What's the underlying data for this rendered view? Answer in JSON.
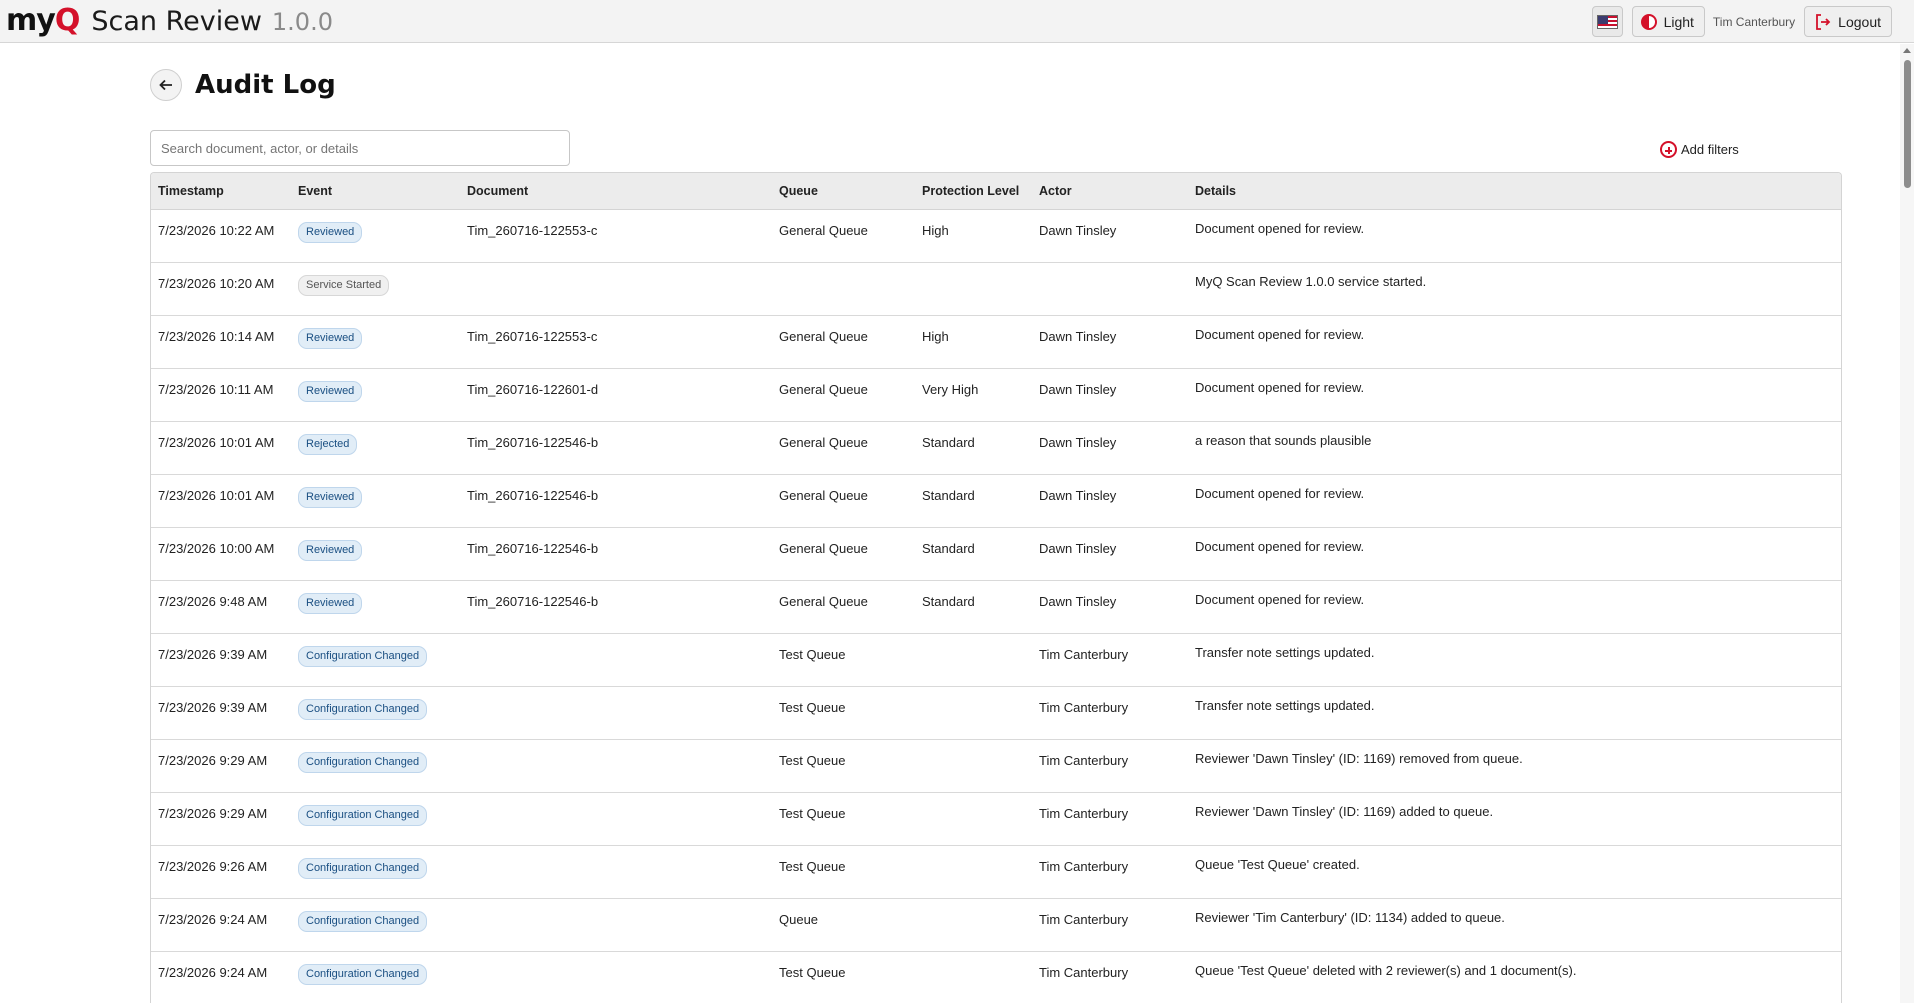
{
  "app": {
    "logo_text": "my",
    "logo_q": "Q",
    "title": "Scan Review",
    "version": "1.0.0"
  },
  "topbar": {
    "language_icon": "us-flag-icon",
    "theme_label": "Light",
    "user_name": "Tim Canterbury",
    "logout_label": "Logout"
  },
  "page": {
    "title": "Audit Log",
    "search_placeholder": "Search document, actor, or details",
    "add_filters_label": "Add filters"
  },
  "colors": {
    "brand_red": "#d4112a",
    "badge_blue_bg": "#e1edf7",
    "badge_blue_text": "#1a4f82"
  },
  "table": {
    "columns": [
      "Timestamp",
      "Event",
      "Document",
      "Queue",
      "Protection Level",
      "Actor",
      "Details"
    ],
    "rows": [
      {
        "timestamp": "7/23/2026 10:22 AM",
        "event": "Reviewed",
        "event_style": "blue",
        "document": "Tim_260716-122553-c",
        "queue": "General Queue",
        "protection": "High",
        "actor": "Dawn Tinsley",
        "details": "Document opened for review."
      },
      {
        "timestamp": "7/23/2026 10:20 AM",
        "event": "Service Started",
        "event_style": "gray",
        "document": "",
        "queue": "",
        "protection": "",
        "actor": "",
        "details": "MyQ Scan Review 1.0.0 service started."
      },
      {
        "timestamp": "7/23/2026 10:14 AM",
        "event": "Reviewed",
        "event_style": "blue",
        "document": "Tim_260716-122553-c",
        "queue": "General Queue",
        "protection": "High",
        "actor": "Dawn Tinsley",
        "details": "Document opened for review."
      },
      {
        "timestamp": "7/23/2026 10:11 AM",
        "event": "Reviewed",
        "event_style": "blue",
        "document": "Tim_260716-122601-d",
        "queue": "General Queue",
        "protection": "Very High",
        "actor": "Dawn Tinsley",
        "details": "Document opened for review."
      },
      {
        "timestamp": "7/23/2026 10:01 AM",
        "event": "Rejected",
        "event_style": "blue",
        "document": "Tim_260716-122546-b",
        "queue": "General Queue",
        "protection": "Standard",
        "actor": "Dawn Tinsley",
        "details": "a reason that sounds plausible"
      },
      {
        "timestamp": "7/23/2026 10:01 AM",
        "event": "Reviewed",
        "event_style": "blue",
        "document": "Tim_260716-122546-b",
        "queue": "General Queue",
        "protection": "Standard",
        "actor": "Dawn Tinsley",
        "details": "Document opened for review."
      },
      {
        "timestamp": "7/23/2026 10:00 AM",
        "event": "Reviewed",
        "event_style": "blue",
        "document": "Tim_260716-122546-b",
        "queue": "General Queue",
        "protection": "Standard",
        "actor": "Dawn Tinsley",
        "details": "Document opened for review."
      },
      {
        "timestamp": "7/23/2026 9:48 AM",
        "event": "Reviewed",
        "event_style": "blue",
        "document": "Tim_260716-122546-b",
        "queue": "General Queue",
        "protection": "Standard",
        "actor": "Dawn Tinsley",
        "details": "Document opened for review."
      },
      {
        "timestamp": "7/23/2026 9:39 AM",
        "event": "Configuration Changed",
        "event_style": "blue",
        "document": "",
        "queue": "Test Queue",
        "protection": "",
        "actor": "Tim Canterbury",
        "details": "Transfer note settings updated."
      },
      {
        "timestamp": "7/23/2026 9:39 AM",
        "event": "Configuration Changed",
        "event_style": "blue",
        "document": "",
        "queue": "Test Queue",
        "protection": "",
        "actor": "Tim Canterbury",
        "details": "Transfer note settings updated."
      },
      {
        "timestamp": "7/23/2026 9:29 AM",
        "event": "Configuration Changed",
        "event_style": "blue",
        "document": "",
        "queue": "Test Queue",
        "protection": "",
        "actor": "Tim Canterbury",
        "details": "Reviewer 'Dawn Tinsley' (ID: 1169) removed from queue."
      },
      {
        "timestamp": "7/23/2026 9:29 AM",
        "event": "Configuration Changed",
        "event_style": "blue",
        "document": "",
        "queue": "Test Queue",
        "protection": "",
        "actor": "Tim Canterbury",
        "details": "Reviewer 'Dawn Tinsley' (ID: 1169) added to queue."
      },
      {
        "timestamp": "7/23/2026 9:26 AM",
        "event": "Configuration Changed",
        "event_style": "blue",
        "document": "",
        "queue": "Test Queue",
        "protection": "",
        "actor": "Tim Canterbury",
        "details": "Queue 'Test Queue' created."
      },
      {
        "timestamp": "7/23/2026 9:24 AM",
        "event": "Configuration Changed",
        "event_style": "blue",
        "document": "",
        "queue": "Queue",
        "protection": "",
        "actor": "Tim Canterbury",
        "details": "Reviewer 'Tim Canterbury' (ID: 1134) added to queue."
      },
      {
        "timestamp": "7/23/2026 9:24 AM",
        "event": "Configuration Changed",
        "event_style": "blue",
        "document": "",
        "queue": "Test Queue",
        "protection": "",
        "actor": "Tim Canterbury",
        "details": "Queue 'Test Queue' deleted with 2 reviewer(s) and 1 document(s)."
      }
    ]
  }
}
